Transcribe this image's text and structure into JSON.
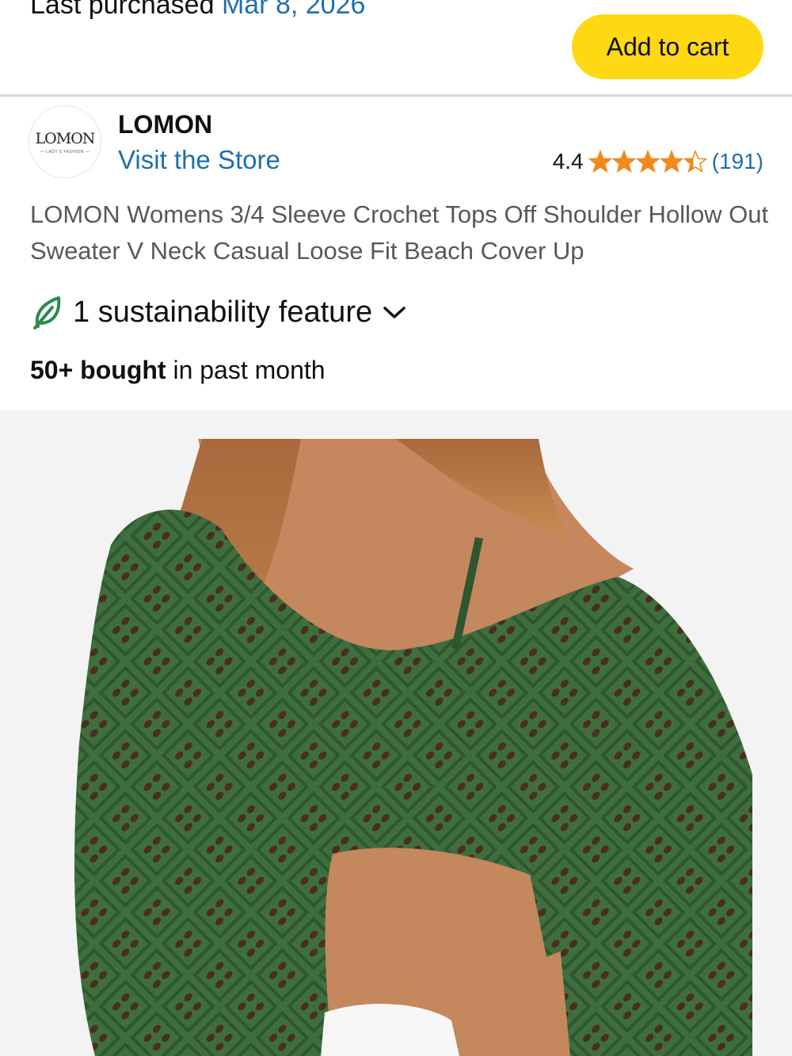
{
  "purchase": {
    "label": "Last purchased",
    "date": "Mar 8, 2026"
  },
  "cart": {
    "button_label": "Add to cart"
  },
  "store": {
    "logo_text": "LOMON",
    "logo_subtext": "— LADY'S FASHION —",
    "brand": "LOMON",
    "visit_label": "Visit the Store"
  },
  "rating": {
    "value": "4.4",
    "stars": 4.4,
    "count": "(191)"
  },
  "product": {
    "title": "LOMON Womens 3/4 Sleeve Crochet Tops Off Shoulder Hollow Out Sweater V Neck Casual Loose Fit Beach Cover Up",
    "sustainability": "1 sustainability feature",
    "bought_bold": "50+ bought",
    "bought_rest": " in past month"
  },
  "colors": {
    "accent_link": "#1f6fae",
    "cart_button": "#ffd814",
    "star": "#f08a1c",
    "leaf": "#2a8a4a"
  },
  "icons": {
    "rating": "star-icon",
    "sustainability": "leaf-icon",
    "expand": "chevron-down-icon"
  }
}
